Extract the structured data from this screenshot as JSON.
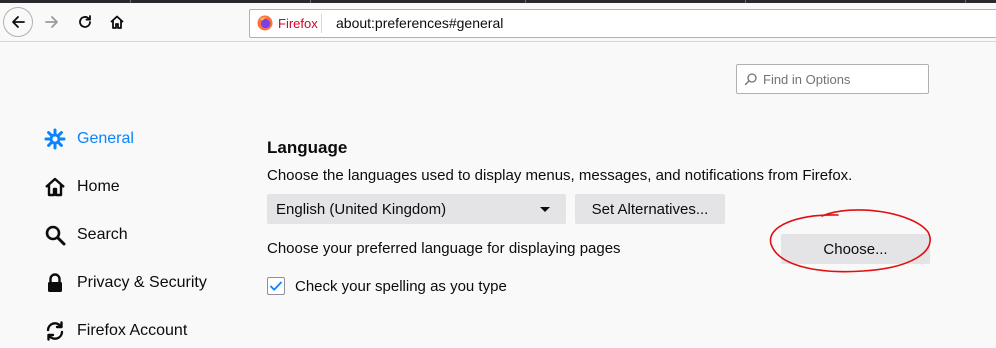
{
  "browser": {
    "identity_label": "Firefox",
    "url": "about:preferences#general",
    "nav_icons": [
      "back-arrow-icon",
      "forward-arrow-icon",
      "reload-icon",
      "home-icon"
    ]
  },
  "search": {
    "placeholder": "Find in Options",
    "icon": "search-icon"
  },
  "sidebar": {
    "items": [
      {
        "label": "General",
        "icon": "gear-icon",
        "selected": true
      },
      {
        "label": "Home",
        "icon": "home-icon",
        "selected": false
      },
      {
        "label": "Search",
        "icon": "search-icon",
        "selected": false
      },
      {
        "label": "Privacy & Security",
        "icon": "lock-icon",
        "selected": false
      },
      {
        "label": "Firefox Account",
        "icon": "sync-icon",
        "selected": false
      }
    ]
  },
  "language": {
    "title": "Language",
    "description": "Choose the languages used to display menus, messages, and notifications from Firefox.",
    "selected_language": "English (United Kingdom)",
    "alternatives_label": "Set Alternatives...",
    "pages_description": "Choose your preferred language for displaying pages",
    "choose_label": "Choose...",
    "spellcheck_label": "Check your spelling as you type",
    "spellcheck_checked": true
  },
  "colors": {
    "accent": "#0a84ff",
    "annotation": "#e01010",
    "button_bg": "#e4e4e6"
  }
}
